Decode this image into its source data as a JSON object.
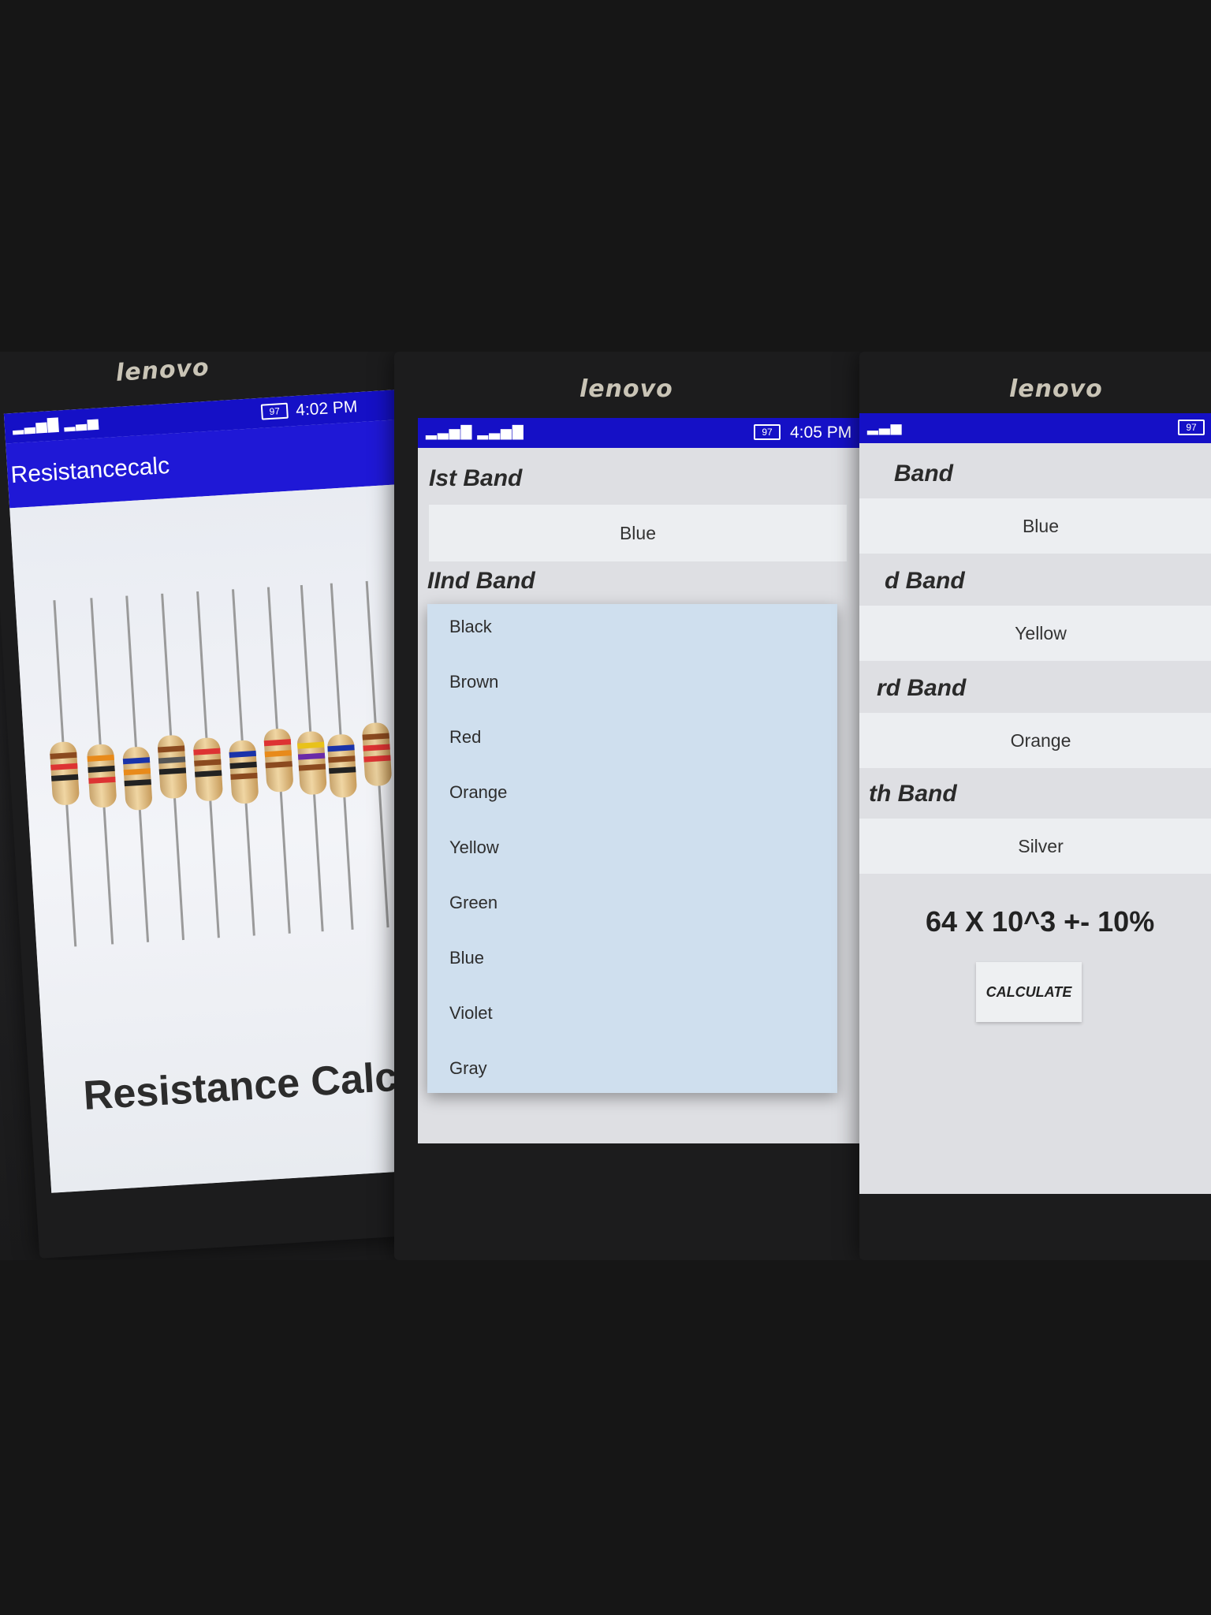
{
  "phone1": {
    "brand": "lenovo",
    "status": {
      "battery": "97",
      "time": "4:02 PM"
    },
    "app_title": "Resistancecalc",
    "hero_title": "Resistance Calculat"
  },
  "phone2": {
    "brand": "lenovo",
    "status": {
      "battery": "97",
      "time": "4:05 PM"
    },
    "band1": {
      "label": "Ist Band",
      "value": "Blue"
    },
    "band2": {
      "label": "IInd Band"
    },
    "dropdown_options": [
      "Black",
      "Brown",
      "Red",
      "Orange",
      "Yellow",
      "Green",
      "Blue",
      "Violet",
      "Gray"
    ]
  },
  "phone3": {
    "brand": "lenovo",
    "status": {
      "battery": "97"
    },
    "bands": [
      {
        "label": "Band",
        "value": "Blue"
      },
      {
        "label": "d Band",
        "value": "Yellow"
      },
      {
        "label": "rd Band",
        "value": "Orange"
      },
      {
        "label": "th Band",
        "value": "Silver"
      }
    ],
    "result": "64  X 10^3 +- 10%",
    "calculate_label": "CALCULATE"
  },
  "colors": {
    "status_bar": "#1510c6",
    "app_bar": "#1f18d6",
    "dropdown_bg": "#cfdfee"
  }
}
